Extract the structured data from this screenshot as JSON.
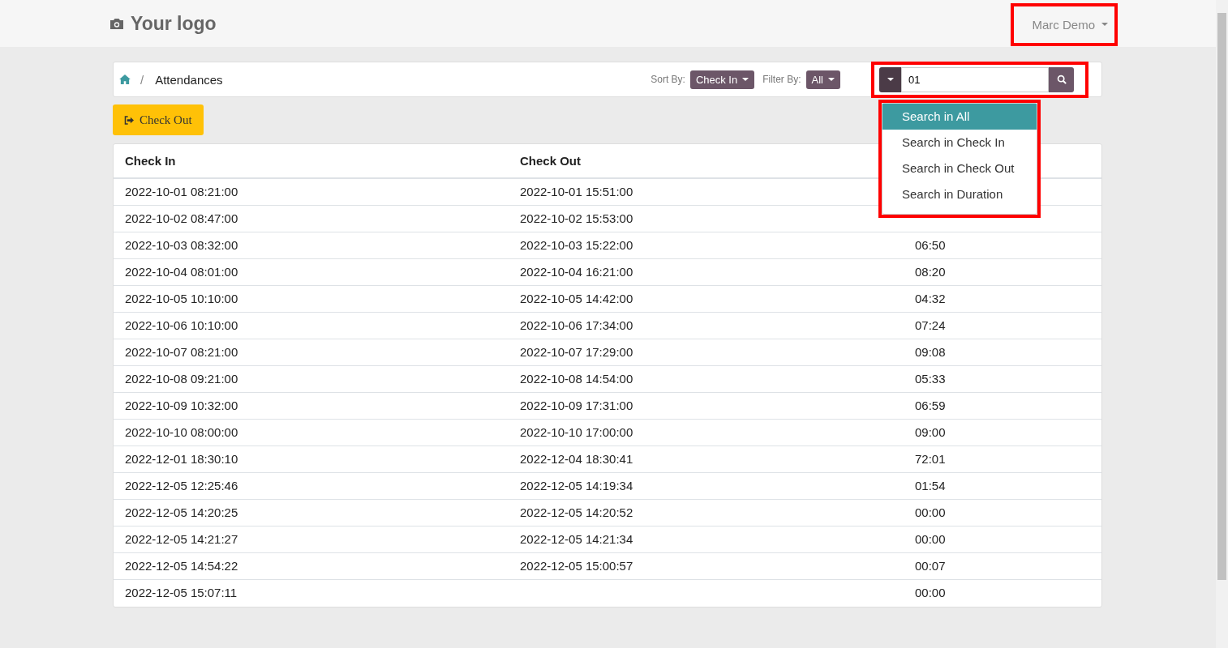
{
  "header": {
    "logo": "Your logo",
    "user": "Marc Demo",
    "user_highlighted": true
  },
  "breadcrumb": {
    "current": "Attendances",
    "separator": "/"
  },
  "sort": {
    "label": "Sort By:",
    "value": "Check In"
  },
  "filter": {
    "label": "Filter By:",
    "value": "All"
  },
  "search": {
    "value": "01",
    "highlighted": true,
    "menu_open": true,
    "options": [
      {
        "label": "Search in All",
        "selected": true
      },
      {
        "label": "Search in Check In",
        "selected": false
      },
      {
        "label": "Search in Check Out",
        "selected": false
      },
      {
        "label": "Search in Duration",
        "selected": false
      }
    ]
  },
  "action_button": "Check Out",
  "table": {
    "columns": [
      "Check In",
      "Check Out"
    ],
    "rows": [
      {
        "check_in": "2022-10-01 08:21:00",
        "check_out": "2022-10-01 15:51:00"
      },
      {
        "check_in": "2022-10-02 08:47:00",
        "check_out": "2022-10-02 15:53:00"
      },
      {
        "check_in": "2022-10-03 08:32:00",
        "check_out": "2022-10-03 15:22:00",
        "duration": "06:50"
      },
      {
        "check_in": "2022-10-04 08:01:00",
        "check_out": "2022-10-04 16:21:00",
        "duration": "08:20"
      },
      {
        "check_in": "2022-10-05 10:10:00",
        "check_out": "2022-10-05 14:42:00",
        "duration": "04:32"
      },
      {
        "check_in": "2022-10-06 10:10:00",
        "check_out": "2022-10-06 17:34:00",
        "duration": "07:24"
      },
      {
        "check_in": "2022-10-07 08:21:00",
        "check_out": "2022-10-07 17:29:00",
        "duration": "09:08"
      },
      {
        "check_in": "2022-10-08 09:21:00",
        "check_out": "2022-10-08 14:54:00",
        "duration": "05:33"
      },
      {
        "check_in": "2022-10-09 10:32:00",
        "check_out": "2022-10-09 17:31:00",
        "duration": "06:59"
      },
      {
        "check_in": "2022-10-10 08:00:00",
        "check_out": "2022-10-10 17:00:00",
        "duration": "09:00"
      },
      {
        "check_in": "2022-12-01 18:30:10",
        "check_out": "2022-12-04 18:30:41",
        "duration": "72:01"
      },
      {
        "check_in": "2022-12-05 12:25:46",
        "check_out": "2022-12-05 14:19:34",
        "duration": "01:54"
      },
      {
        "check_in": "2022-12-05 14:20:25",
        "check_out": "2022-12-05 14:20:52",
        "duration": "00:00"
      },
      {
        "check_in": "2022-12-05 14:21:27",
        "check_out": "2022-12-05 14:21:34",
        "duration": "00:00"
      },
      {
        "check_in": "2022-12-05 14:54:22",
        "check_out": "2022-12-05 15:00:57",
        "duration": "00:07"
      },
      {
        "check_in": "2022-12-05 15:07:11",
        "duration": "00:00"
      }
    ]
  }
}
